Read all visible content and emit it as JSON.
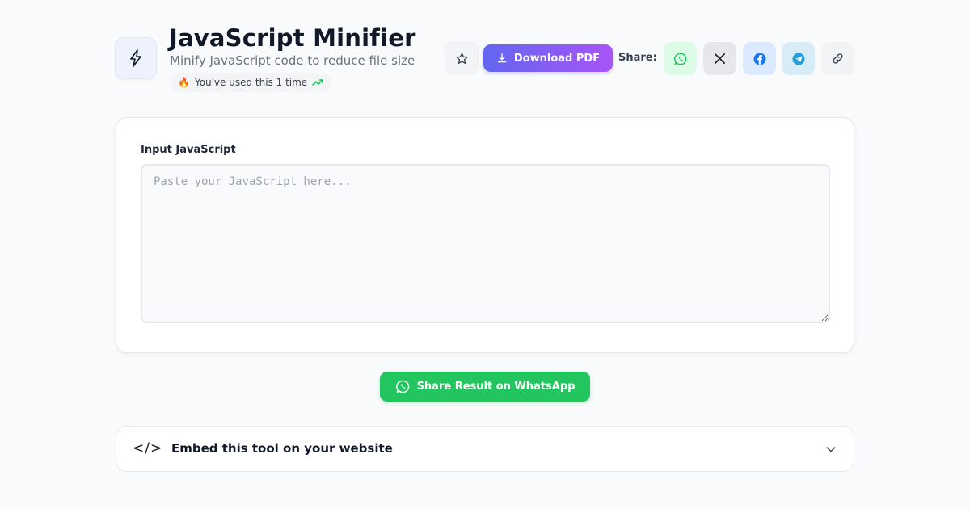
{
  "header": {
    "title": "JavaScript Minifier",
    "subtitle": "Minify JavaScript code to reduce file size",
    "usage_emoji": "🔥",
    "usage_text": "You've used this 1 time",
    "download_pdf_label": "Download PDF",
    "share_label": "Share:"
  },
  "icons": {
    "tool": "lightning-icon",
    "favorite": "star-icon",
    "download": "download-icon",
    "usage_trend": "trending-up-icon",
    "share": [
      "whatsapp-icon",
      "x-icon",
      "facebook-icon",
      "telegram-icon",
      "link-icon"
    ],
    "embed": "code-icon",
    "embed_toggle": "chevron-down-icon"
  },
  "main": {
    "input_label": "Input JavaScript",
    "input_placeholder": "Paste your JavaScript here...",
    "input_value": ""
  },
  "actions": {
    "share_whatsapp_label": "Share Result on WhatsApp"
  },
  "embed": {
    "code_glyph": "</>",
    "title": "Embed this tool on your website"
  },
  "colors": {
    "primary_gradient_start": "#6366f1",
    "primary_gradient_end": "#a855f7",
    "whatsapp": "#22c55e",
    "facebook": "#1877f2",
    "telegram": "#229ed9",
    "background": "#f8fafc"
  }
}
